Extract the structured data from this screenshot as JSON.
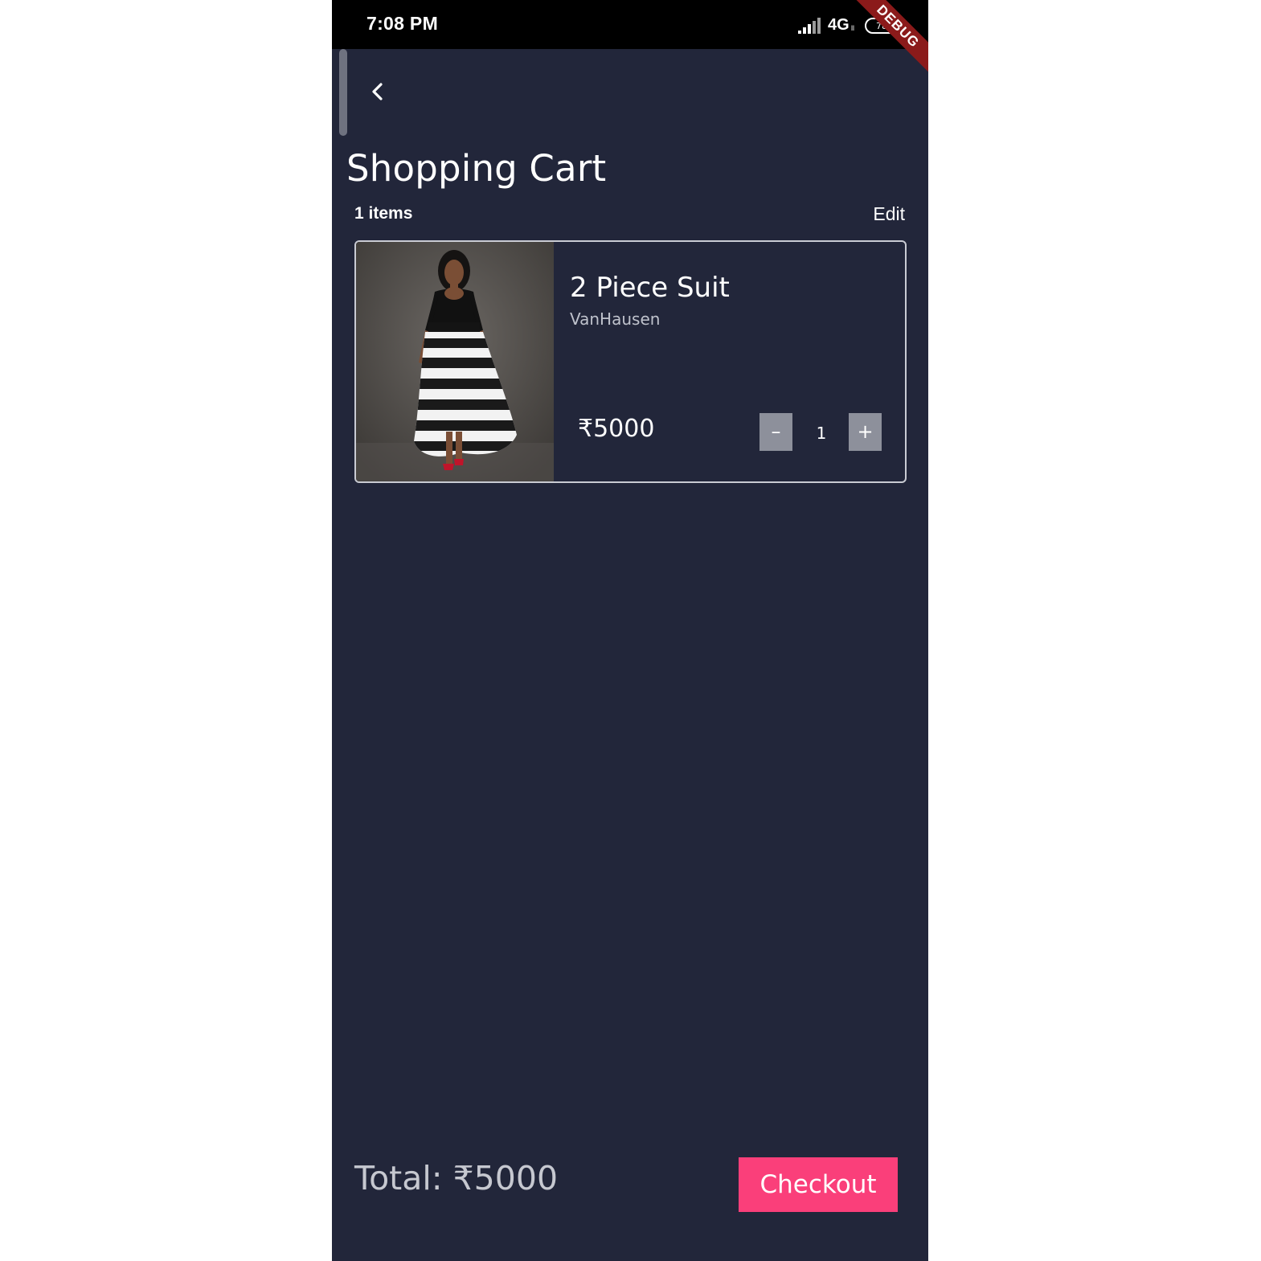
{
  "status_bar": {
    "time": "7:08 PM",
    "network": "4G",
    "network_sub": "ll",
    "battery_level": "78",
    "debug_banner": "DEBUG"
  },
  "header": {
    "back_icon": "chevron-left-icon",
    "title": "Shopping Cart"
  },
  "cart": {
    "items_count_label": "1 items",
    "edit_label": "Edit",
    "items": [
      {
        "name": "2 Piece Suit",
        "brand": "VanHausen",
        "price": "₹5000",
        "quantity": "1",
        "minus_label": "–",
        "plus_label": "+"
      }
    ]
  },
  "footer": {
    "total_label": "Total: ₹5000",
    "checkout_label": "Checkout"
  },
  "colors": {
    "background": "#22263a",
    "accent": "#fa3f7a",
    "qty_button": "#8d909b",
    "debug_banner": "#8b1a1a"
  }
}
